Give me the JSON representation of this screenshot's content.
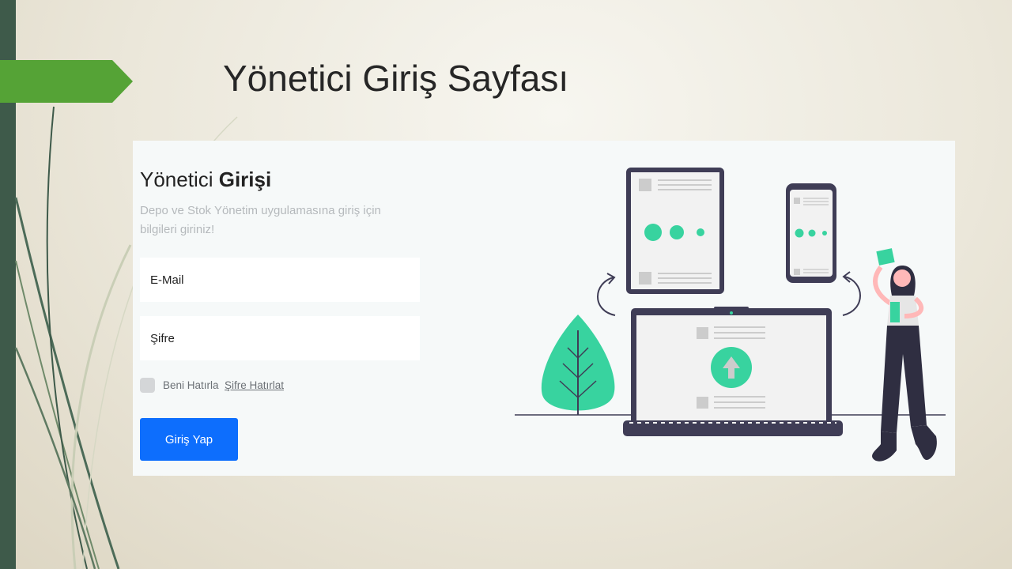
{
  "slide": {
    "title": "Yönetici Giriş Sayfası"
  },
  "login": {
    "heading_regular": "Yönetici",
    "heading_bold": "Girişi",
    "subtitle": "Depo ve Stok Yönetim uygulamasına giriş için bilgileri giriniz!",
    "email_placeholder": "E-Mail",
    "password_placeholder": "Şifre",
    "remember_label": "Beni Hatırla",
    "forgot_link": "Şifre Hatırlat",
    "submit_label": "Giriş Yap"
  },
  "colors": {
    "primary_button": "#0d6efd",
    "accent_green": "#38d39f",
    "slide_band": "#3e5a4a",
    "title_arrow": "#55a336"
  }
}
